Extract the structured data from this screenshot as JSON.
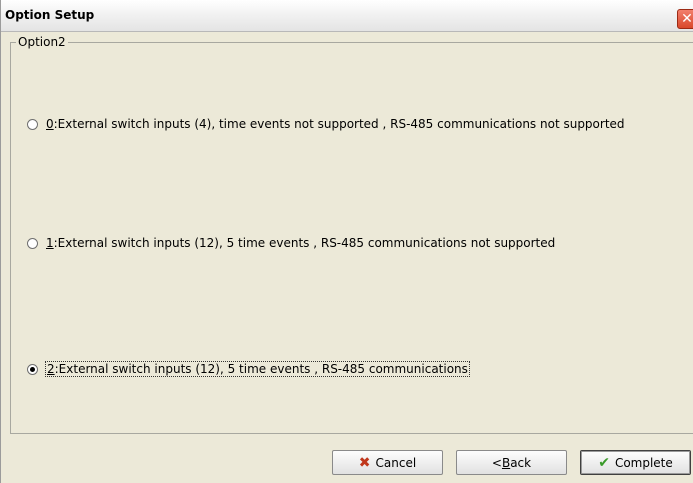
{
  "window": {
    "title": "Option Setup",
    "close_glyph": "✕"
  },
  "group": {
    "legend": "Option2"
  },
  "options": [
    {
      "key": "0",
      "text": ":External switch inputs (4), time events not supported , RS-485 communications not supported",
      "checked": false
    },
    {
      "key": "1",
      "text": ":External switch inputs (12), 5 time events , RS-485 communications not supported",
      "checked": false
    },
    {
      "key": "2",
      "text": ":External switch inputs (12), 5 time events , RS-485 communications",
      "checked": true
    }
  ],
  "buttons": {
    "cancel": {
      "label": "Cancel",
      "icon": "x-icon"
    },
    "back": {
      "prefix": "<",
      "mnemonic": "B",
      "rest": "ack"
    },
    "complete": {
      "label": "Complete",
      "icon": "check-icon"
    }
  },
  "colors": {
    "cancel_icon": "#c0371c",
    "complete_icon": "#3a9a2a",
    "dialog_bg": "#ece9d8"
  }
}
